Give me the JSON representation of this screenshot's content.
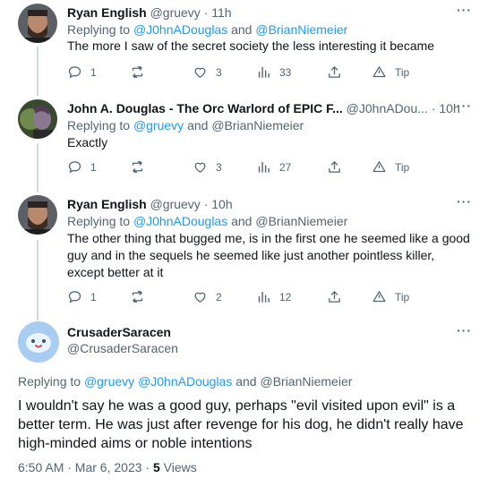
{
  "tweets": [
    {
      "name": "Ryan English",
      "handle": "@gruevy",
      "time": "11h",
      "replying_prefix": "Replying to",
      "mentions": [
        "@J0hnADouglas"
      ],
      "and_word": "and",
      "last_mention": "@BrianNiemeier",
      "text": "The more I saw of the secret society the less interesting it became",
      "replies": "1",
      "retweets": "",
      "likes": "3",
      "views": "33",
      "tip": "Tip"
    },
    {
      "name": "John A. Douglas - The Orc Warlord of EPIC F...",
      "handle": "@J0hnADou...",
      "time": "10h",
      "replying_prefix": "Replying to",
      "mentions": [
        "@gruevy"
      ],
      "and_word": "and",
      "last_mention": "@BrianNiemeier",
      "text": "Exactly",
      "replies": "1",
      "retweets": "",
      "likes": "3",
      "views": "27",
      "tip": "Tip"
    },
    {
      "name": "Ryan English",
      "handle": "@gruevy",
      "time": "10h",
      "replying_prefix": "Replying to",
      "mentions": [
        "@J0hnADouglas"
      ],
      "and_word": "and",
      "last_mention": "@BrianNiemeier",
      "text": "The other thing that bugged me, is in the first one he seemed like a good guy and in the sequels he seemed like just another pointless killer, except better at it",
      "replies": "1",
      "retweets": "",
      "likes": "2",
      "views": "12",
      "tip": "Tip"
    }
  ],
  "main": {
    "name": "CrusaderSaracen",
    "handle": "@CrusaderSaracen",
    "replying_prefix": "Replying to",
    "mention1": "@gruevy",
    "mention2": "@J0hnADouglas",
    "and_word": "and",
    "mention3": "@BrianNiemeier",
    "text": "I wouldn't say he was a good guy, perhaps \"evil visited upon evil\" is a better term. He was just after revenge for his dog, he didn't really have high-minded aims or noble intentions",
    "timestamp": "6:50 AM · Mar 6, 2023 ·",
    "views_count": "5",
    "views_label": "Views"
  },
  "colors": {
    "accent": "#1d9bf0",
    "secondary_text": "#536471",
    "thread_line": "#cfd9de",
    "avatar_bg": "#a9cdf0"
  },
  "icons": {
    "more": "more-dots-icon",
    "reply": "reply-icon",
    "retweet": "retweet-icon",
    "like": "heart-icon",
    "views": "views-bar-icon",
    "share": "share-icon",
    "tip": "tip-icon"
  },
  "more_symbol": "···"
}
